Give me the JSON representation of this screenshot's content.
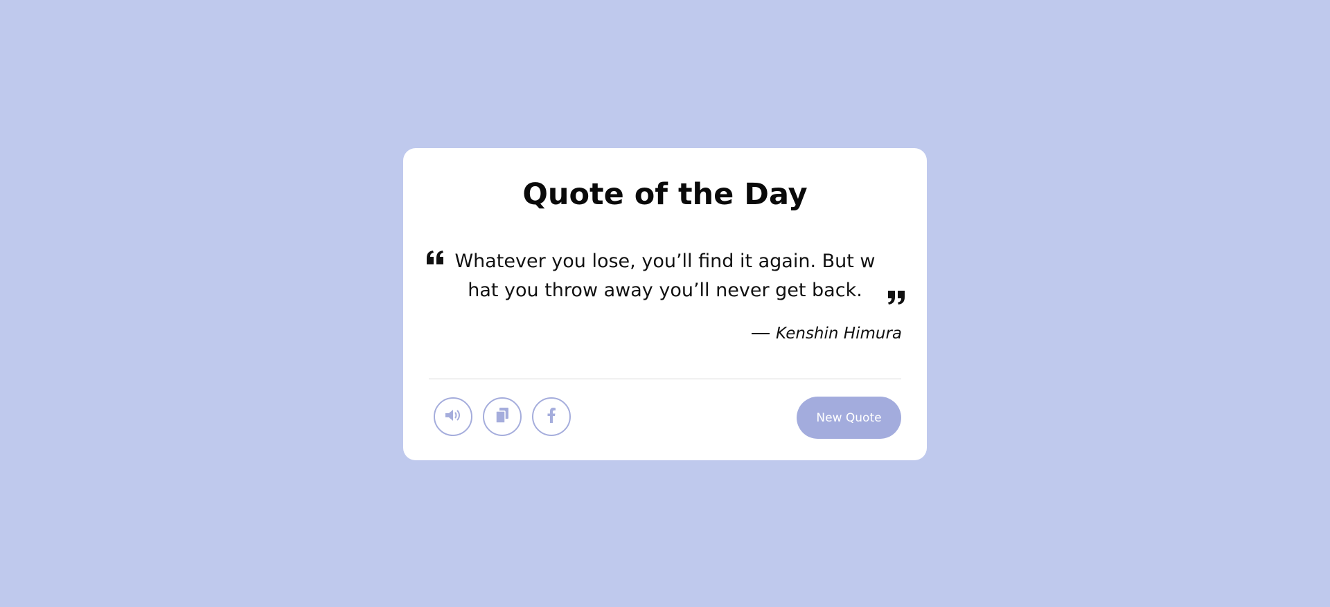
{
  "card": {
    "title": "Quote of the Day",
    "quote": "Whatever you lose, you’ll find it again. But what you throw away you’ll never get back.",
    "author": "Kenshin Himura",
    "new_quote_label": "New Quote"
  },
  "icons": {
    "open_quote": "quote-left-icon",
    "close_quote": "quote-right-icon",
    "speech": "volume-icon",
    "copy": "copy-icon",
    "share": "facebook-icon"
  },
  "colors": {
    "background": "#bfc9ed",
    "accent": "#a3acdd",
    "icon_border": "#a5addc"
  }
}
